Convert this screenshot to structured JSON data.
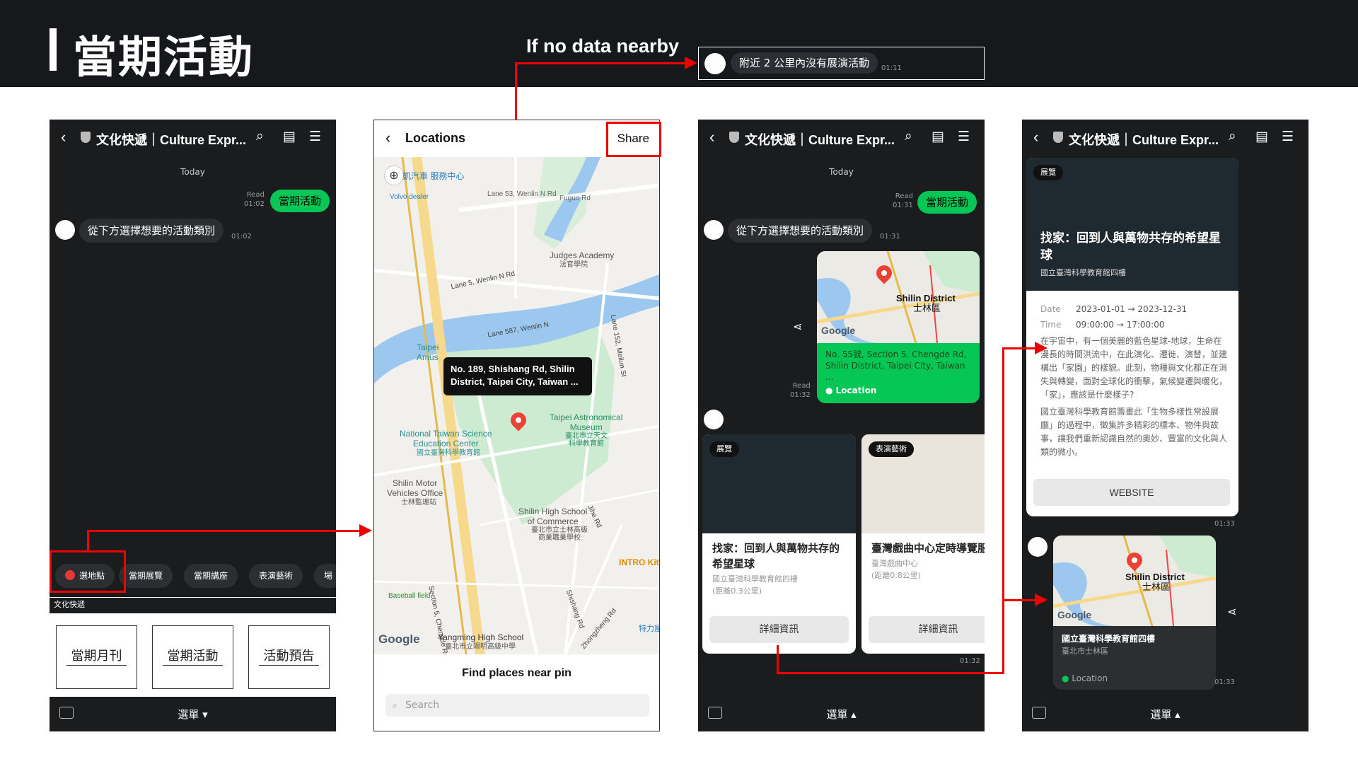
{
  "page": {
    "title": "當期活動",
    "no_data_label": "If no data nearby"
  },
  "toast": {
    "message": "附近 2 公里內沒有展演活動",
    "time": "01:11"
  },
  "chat_header": {
    "title": "文化快遞｜Culture Expr..."
  },
  "p1": {
    "today": "Today",
    "read": "Read",
    "read_time": "01:02",
    "user_msg": "當期活動",
    "bot_msg": "從下方選擇想要的活動類別",
    "bot_time": "01:02",
    "chips": [
      "選地點",
      "當期展覽",
      "當期講座",
      "表演藝術",
      "場"
    ],
    "strip": "文化快遞",
    "rich": [
      "當期月刊",
      "當期活動",
      "活動預告"
    ],
    "menu": "選單 ▾"
  },
  "p2": {
    "title": "Locations",
    "share": "Share",
    "tooltip": "No. 189, Shishang Rd, Shilin District, Taipei City, Taiwan ...",
    "labels": {
      "volvo": "凱汽車\n服務中心",
      "volvo_en": "Volvo dealer",
      "lane53": "Lane 53, Wenlin N Rd",
      "fuguo": "Fuguo Rd",
      "judges": "Judges Academy",
      "judges_zh": "法官學院",
      "lane5": "Lane 5, Wenlin N Rd",
      "lane587": "Lane 587, Wenlin N",
      "lane152": "Lane 152, Meilun St",
      "astro": "Taipei Astronomical\nMuseum",
      "astro_zh": "臺北市立天文\n科學教育館",
      "ntsec": "National Taiwan Science\nEducation Center",
      "ntsec_zh": "國立臺灣科學教育館",
      "motor": "Shilin Motor\nVehicles Office",
      "motor_zh": "士林監理站",
      "shilin_hs": "Shilin High School\nof Commerce",
      "shilin_hs_zh": "臺北市立士林高級\n商業職業學校",
      "intro": "INTRO Kit",
      "baseball": "Baseball field",
      "yangming": "Yangming High School",
      "yangming_zh": "臺北市立陽明高級中學",
      "tewli": "特力屋",
      "chengde": "Section 5, Chengde Rd",
      "shishang": "Shishang Rd",
      "jihe": "Jihe Rd",
      "zhongzheng": "Zhongzheng Rd",
      "taipei_amus": "Taipei\nAmus",
      "google": "Google"
    },
    "find": "Find places near pin",
    "search": "Search"
  },
  "p3": {
    "today": "Today",
    "read": "Read",
    "read_time": "01:31",
    "user_msg": "當期活動",
    "bot_msg": "從下方選擇想要的活動類別",
    "bot_time": "01:31",
    "loc_district": "Shilin District",
    "loc_district_zh": "士林區",
    "loc_addr": "No. 55號, Section 5, Chengde Rd, Shilin District, Taipei City, Taiwan ...",
    "loc_label": "Location",
    "loc_read": "Read",
    "loc_read_time": "01:32",
    "card1": {
      "badge": "展覽",
      "title": "找家：回到人與萬物共存的希望星球",
      "venue": "國立臺灣科學教育館四樓",
      "dist": "(距離0.3公里)",
      "btn": "詳細資訊"
    },
    "card2": {
      "badge": "表演藝術",
      "title": "臺灣戲曲中心定時導覽服",
      "venue": "臺灣戲曲中心",
      "dist": "(距離0.8公里)",
      "btn": "詳細資訊"
    },
    "cards_time": "01:32",
    "menu": "選單 ▴"
  },
  "p4": {
    "badge": "展覽",
    "title": "找家：回到人與萬物共存的希望星球",
    "venue": "國立臺灣科學教育館四樓",
    "date_label": "Date",
    "date_value": "2023-01-01 → 2023-12-31",
    "time_label": "Time",
    "time_value": "09:00:00 → 17:00:00",
    "desc1": "在宇宙中，有一個美麗的藍色星球-地球，生命在漫長的時間洪流中，在此演化、遷徙、演替，並建構出「家園」的樣貌。此刻，物種與文化都正在消失與轉變，面對全球化的衝擊，氣候變遷與暖化，「家」，應該是什麼樣子?",
    "desc2": "國立臺灣科學教育館籌畫此「生物多樣性常設展廳」的過程中，徵集許多精彩的標本、物件與故事，讓我們重新認識自然的奧妙、豐富的文化與人類的微小。",
    "website": "WEBSITE",
    "card_time": "01:33",
    "loc_district": "Shilin District",
    "loc_district_zh": "士林區",
    "loc_name": "國立臺灣科學教育館四樓",
    "loc_sub": "臺北市士林區",
    "loc_label": "Location",
    "loc_time": "01:33",
    "menu": "選單 ▴"
  },
  "icons": [
    "chevron-left-icon",
    "shield-icon",
    "search-icon",
    "note-icon",
    "menu-icon",
    "keyboard-icon",
    "share-icon",
    "map-pin-icon",
    "locate-icon"
  ],
  "colors": {
    "line_green": "#06c755",
    "dark": "#1b1c1e",
    "accent_red": "#e00000"
  }
}
